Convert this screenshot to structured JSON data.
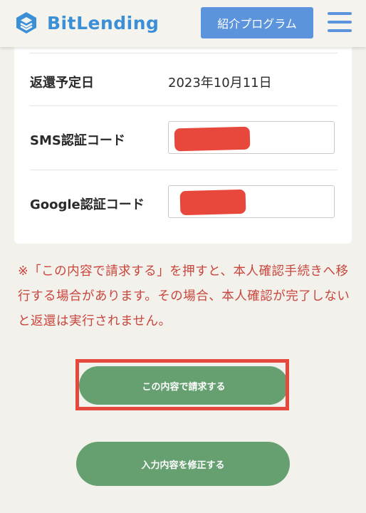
{
  "header": {
    "logo_text": "BitLending",
    "referral_button": "紹介プログラム",
    "menu_icon": "hamburger-menu-icon"
  },
  "form": {
    "return_date": {
      "label": "返還予定日",
      "value": "2023年10月11日"
    },
    "sms_code": {
      "label": "SMS認証コード",
      "value": ""
    },
    "google_code": {
      "label": "Google認証コード",
      "value": ""
    }
  },
  "notice": "※「この内容で請求する」を押すと、本人確認手続きへ移行する場合があります。その場合、本人確認が完了しないと返還は実行されません。",
  "buttons": {
    "submit": "この内容で請求する",
    "edit": "入力内容を修正する"
  },
  "colors": {
    "brand_blue": "#3a8fd6",
    "button_blue": "#5b94dc",
    "button_green": "#66a071",
    "notice_red": "#c9463d",
    "highlight_red": "#e5483c",
    "background": "#f2f1eb"
  }
}
